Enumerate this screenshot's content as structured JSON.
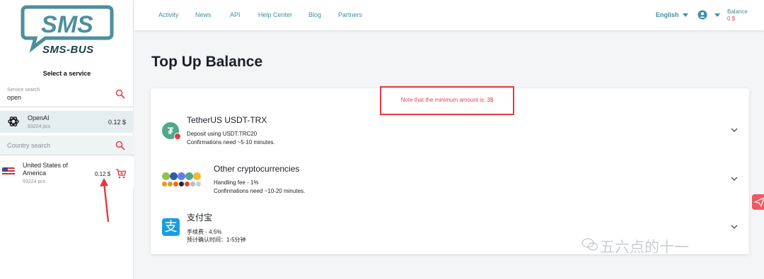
{
  "brand": {
    "logo_text": "SMS",
    "sub_text": "SMS-BUS"
  },
  "sidebar": {
    "title": "Select a service",
    "service_search": {
      "label": "Service search",
      "value": "open"
    },
    "service": {
      "name": "OpenAI",
      "count": "93224 pcs",
      "price": "0.12 $"
    },
    "country_search": {
      "placeholder": "Country search"
    },
    "country": {
      "name": "United States of America",
      "count": "93224 pcs",
      "price": "0.12 $"
    }
  },
  "nav": {
    "links": [
      "Activity",
      "News",
      "API",
      "Help Center",
      "Blog",
      "Partners"
    ],
    "language": "English",
    "balance_label": "Balance",
    "balance_value": "0 $"
  },
  "main": {
    "title": "Top Up Balance",
    "note": "Note that the minimum amount is: 3$",
    "methods": [
      {
        "title": "TetherUS USDT-TRX",
        "line1": "Deposit using USDT.TRC20",
        "line2": "Confirmations need ~5-10 minutes."
      },
      {
        "title": "Other cryptocurrencies",
        "line1": "Handling fee - 1%",
        "line2": "Confirmations need ~10-20 minutes."
      },
      {
        "title": "支付宝",
        "line1": "手续费 - 4.5%",
        "line2": "预计确认时间：1-5分钟"
      }
    ]
  },
  "watermark": "五六点的十一",
  "colors": {
    "accent": "#3f8fa0",
    "alert": "#e0454e",
    "highlight_row": "#e4eef0"
  },
  "icons": [
    "search-icon",
    "openai-icon",
    "us-flag-icon",
    "cart-icon",
    "user-icon",
    "chevron-down-icon",
    "tether-icon",
    "crypto-coins-icon",
    "alipay-icon",
    "telegram-icon",
    "annotation-arrow"
  ]
}
